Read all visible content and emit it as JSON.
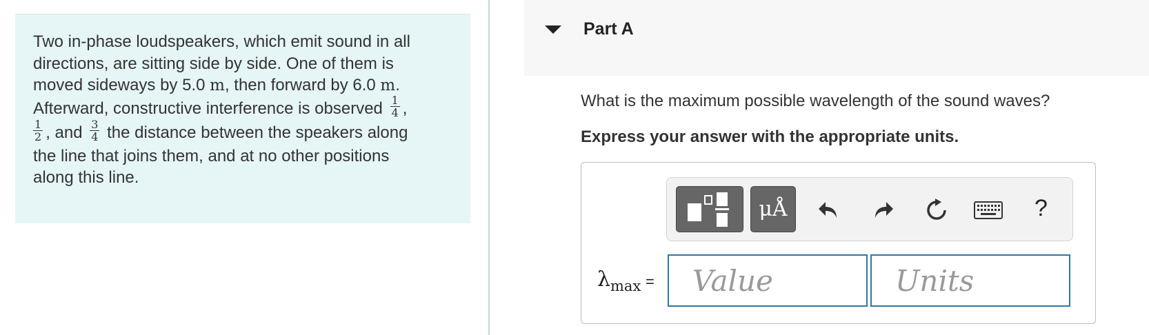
{
  "problem": {
    "line1": "Two in-phase loudspeakers, which emit sound in all",
    "line2": "directions, are sitting side by side. One of them is",
    "line3_a": "moved sideways by 5.0 ",
    "unit_m": "m",
    "line3_b": ", then forward by 6.0 ",
    "line3_c": ".",
    "line4_a": "Afterward, constructive interference is observed",
    "frac1_num": "1",
    "frac1_den": "4",
    "line4_b": ",",
    "frac2_num": "1",
    "frac2_den": "2",
    "line5_a": ", and",
    "frac3_num": "3",
    "frac3_den": "4",
    "line5_b": "the distance between the speakers along",
    "line6": "the line that joins them, and at no other positions",
    "line7": "along this line."
  },
  "part": {
    "title": "Part A",
    "question": "What is the maximum possible wavelength of the sound waves?",
    "instruction": "Express your answer with the appropriate units."
  },
  "toolbar": {
    "units_button_label": "μÅ",
    "help_label": "?",
    "icons": [
      "templates-icon",
      "units-icon",
      "undo-icon",
      "redo-icon",
      "reset-icon",
      "keyboard-icon",
      "help-icon"
    ]
  },
  "answer": {
    "variable": "λ",
    "subscript": "max",
    "equals": "=",
    "value_placeholder": "Value",
    "units_placeholder": "Units"
  },
  "colors": {
    "problem_bg": "#e6f5f6",
    "input_border": "#2a7aa3",
    "toolbar_button": "#666666"
  }
}
